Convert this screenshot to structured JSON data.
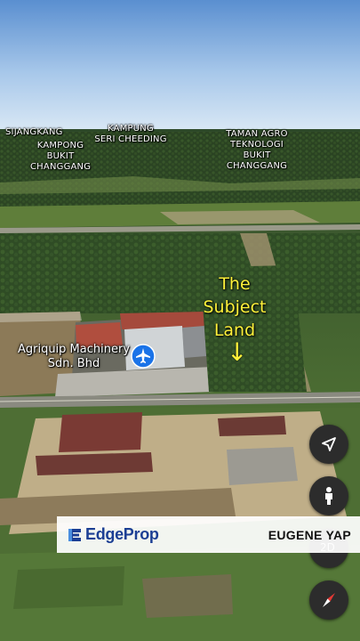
{
  "map": {
    "places": [
      {
        "name": "SIJANGKANG"
      },
      {
        "name": "KAMPUNG\nSERI CHEEDING"
      },
      {
        "name": "KAMPONG\nBUKIT\nCHANGGANG"
      },
      {
        "name": "TAMAN AGRO\nTEKNOLOGI\nBUKIT\nCHANGGANG"
      }
    ],
    "poi": {
      "label": "Agriquip Machinery Sdn. Bhd",
      "icon": "airplane-icon",
      "pin_color": "#1a73e8"
    },
    "annotation": {
      "text": "The\nSubject\nLand",
      "arrow": "↓",
      "color": "#fff23a"
    }
  },
  "controls": {
    "navigate_icon": "navigation-arrow-icon",
    "streetview_icon": "pegman-icon",
    "view_mode": "2D",
    "compass_icon": "compass-icon"
  },
  "banner": {
    "brand": "EdgeProp",
    "agent": "EUGENE YAP",
    "brand_color": "#1c3f94"
  }
}
